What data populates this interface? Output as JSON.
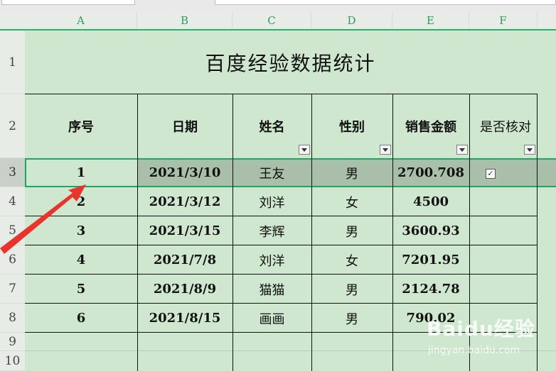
{
  "column_headers": [
    "A",
    "B",
    "C",
    "D",
    "E",
    "F"
  ],
  "row_headers": [
    "1",
    "2",
    "3",
    "4",
    "5",
    "6",
    "7",
    "8",
    "9",
    "10"
  ],
  "title": "百度经验数据统计",
  "table_headers": [
    "序号",
    "日期",
    "姓名",
    "性别",
    "销售金额",
    "是否核对"
  ],
  "rows": [
    {
      "no": "1",
      "date": "2021/3/10",
      "name": "王友",
      "gender": "男",
      "amount": "2700.708",
      "checked": true
    },
    {
      "no": "2",
      "date": "2021/3/12",
      "name": "刘洋",
      "gender": "女",
      "amount": "4500",
      "checked": false
    },
    {
      "no": "3",
      "date": "2021/3/15",
      "name": "李辉",
      "gender": "男",
      "amount": "3600.93",
      "checked": false
    },
    {
      "no": "4",
      "date": "2021/7/8",
      "name": "刘洋",
      "gender": "女",
      "amount": "7201.95",
      "checked": false
    },
    {
      "no": "5",
      "date": "2021/8/9",
      "name": "猫猫",
      "gender": "男",
      "amount": "2124.78",
      "checked": false
    },
    {
      "no": "6",
      "date": "2021/8/15",
      "name": "画画",
      "gender": "男",
      "amount": "790.02",
      "checked": false
    }
  ],
  "selected_row": "3",
  "checkbox_glyph": "✓",
  "watermark": {
    "brand": "Baidu经验",
    "url": "jingyan.baidu.com"
  },
  "colors": {
    "sheet_bg": "#cfe7cf",
    "selection_border": "#21a366",
    "selected_fill": "#a9bfa9",
    "arrow": "#e8352b"
  }
}
